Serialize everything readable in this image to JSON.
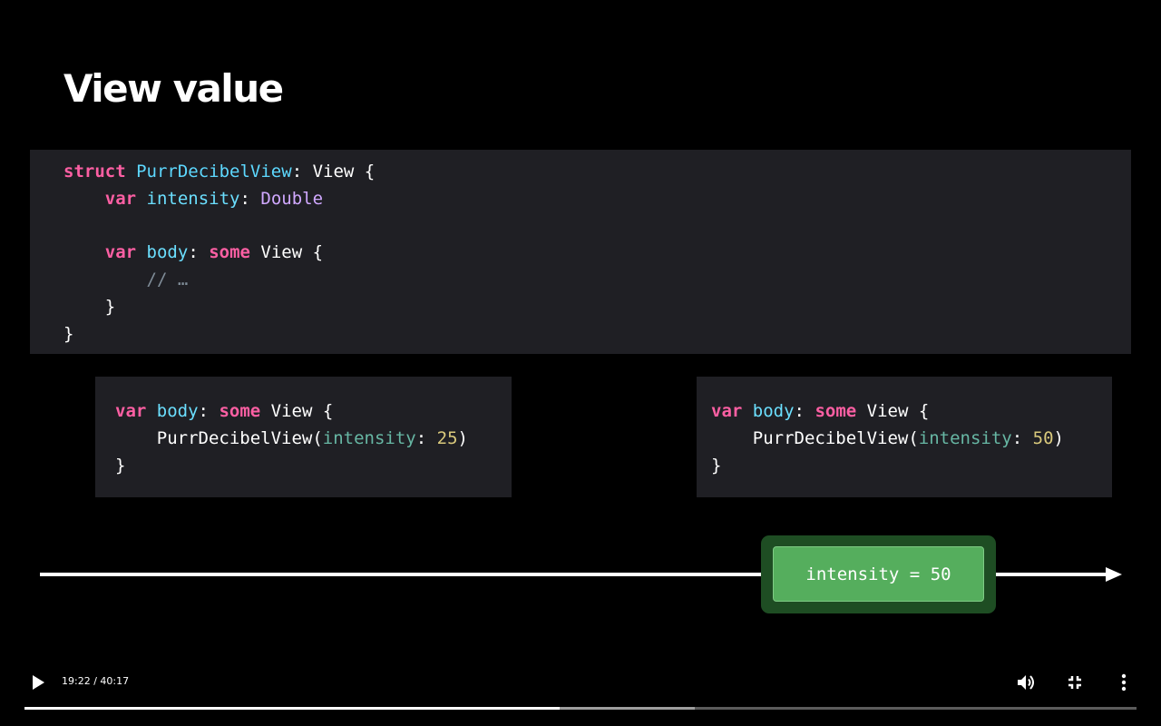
{
  "slide": {
    "title": "View value"
  },
  "main_code": {
    "lines": [
      [
        {
          "t": "struct",
          "c": "kw"
        },
        {
          "t": " ",
          "c": "plain"
        },
        {
          "t": "PurrDecibelView",
          "c": "type"
        },
        {
          "t": ": View {",
          "c": "typeplain"
        }
      ],
      [
        {
          "t": "    ",
          "c": "plain"
        },
        {
          "t": "var",
          "c": "kw"
        },
        {
          "t": " ",
          "c": "plain"
        },
        {
          "t": "intensity",
          "c": "prop"
        },
        {
          "t": ": ",
          "c": "plain"
        },
        {
          "t": "Double",
          "c": "sys"
        }
      ],
      [],
      [
        {
          "t": "    ",
          "c": "plain"
        },
        {
          "t": "var",
          "c": "kw"
        },
        {
          "t": " ",
          "c": "plain"
        },
        {
          "t": "body",
          "c": "prop"
        },
        {
          "t": ": ",
          "c": "plain"
        },
        {
          "t": "some",
          "c": "kw"
        },
        {
          "t": " View {",
          "c": "plain"
        }
      ],
      [
        {
          "t": "        ",
          "c": "plain"
        },
        {
          "t": "// …",
          "c": "comment"
        }
      ],
      [
        {
          "t": "    }",
          "c": "plain"
        }
      ],
      [
        {
          "t": "}",
          "c": "plain"
        }
      ]
    ]
  },
  "code_left": {
    "lines": [
      [
        {
          "t": "var",
          "c": "kw"
        },
        {
          "t": " ",
          "c": "plain"
        },
        {
          "t": "body",
          "c": "prop"
        },
        {
          "t": ": ",
          "c": "plain"
        },
        {
          "t": "some",
          "c": "kw"
        },
        {
          "t": " View {",
          "c": "plain"
        }
      ],
      [
        {
          "t": "    PurrDecibelView(",
          "c": "plain"
        },
        {
          "t": "intensity",
          "c": "arg"
        },
        {
          "t": ": ",
          "c": "plain"
        },
        {
          "t": "25",
          "c": "num"
        },
        {
          "t": ")",
          "c": "plain"
        }
      ],
      [
        {
          "t": "}",
          "c": "plain"
        }
      ]
    ]
  },
  "code_right": {
    "lines": [
      [
        {
          "t": "var",
          "c": "kw"
        },
        {
          "t": " ",
          "c": "plain"
        },
        {
          "t": "body",
          "c": "prop"
        },
        {
          "t": ": ",
          "c": "plain"
        },
        {
          "t": "some",
          "c": "kw"
        },
        {
          "t": " View {",
          "c": "plain"
        }
      ],
      [
        {
          "t": "    PurrDecibelView(",
          "c": "plain"
        },
        {
          "t": "intensity",
          "c": "arg"
        },
        {
          "t": ": ",
          "c": "plain"
        },
        {
          "t": "50",
          "c": "num"
        },
        {
          "t": ")",
          "c": "plain"
        }
      ],
      [
        {
          "t": "}",
          "c": "plain"
        }
      ]
    ]
  },
  "timeline": {
    "event_label": "intensity = 50"
  },
  "player": {
    "time_display": "19:22 / 40:17",
    "progress_played_fraction": 0.481,
    "progress_buffered_fraction": 0.603,
    "icons": {
      "play": "play-icon",
      "volume": "volume-icon",
      "exit_fullscreen": "exit-fullscreen-icon",
      "more": "more-options-icon"
    }
  },
  "colors": {
    "background": "#000000",
    "code_background": "#1f1f24",
    "keyword": "#fc5fa3",
    "type": "#5dd8ff",
    "property": "#6bdfff",
    "system_type": "#d0a8ff",
    "argument_label": "#67b7a4",
    "number": "#d9c97c",
    "comment": "#7f8c98",
    "event_chip": "#55ae5d",
    "event_halo": "#1e4d23"
  }
}
